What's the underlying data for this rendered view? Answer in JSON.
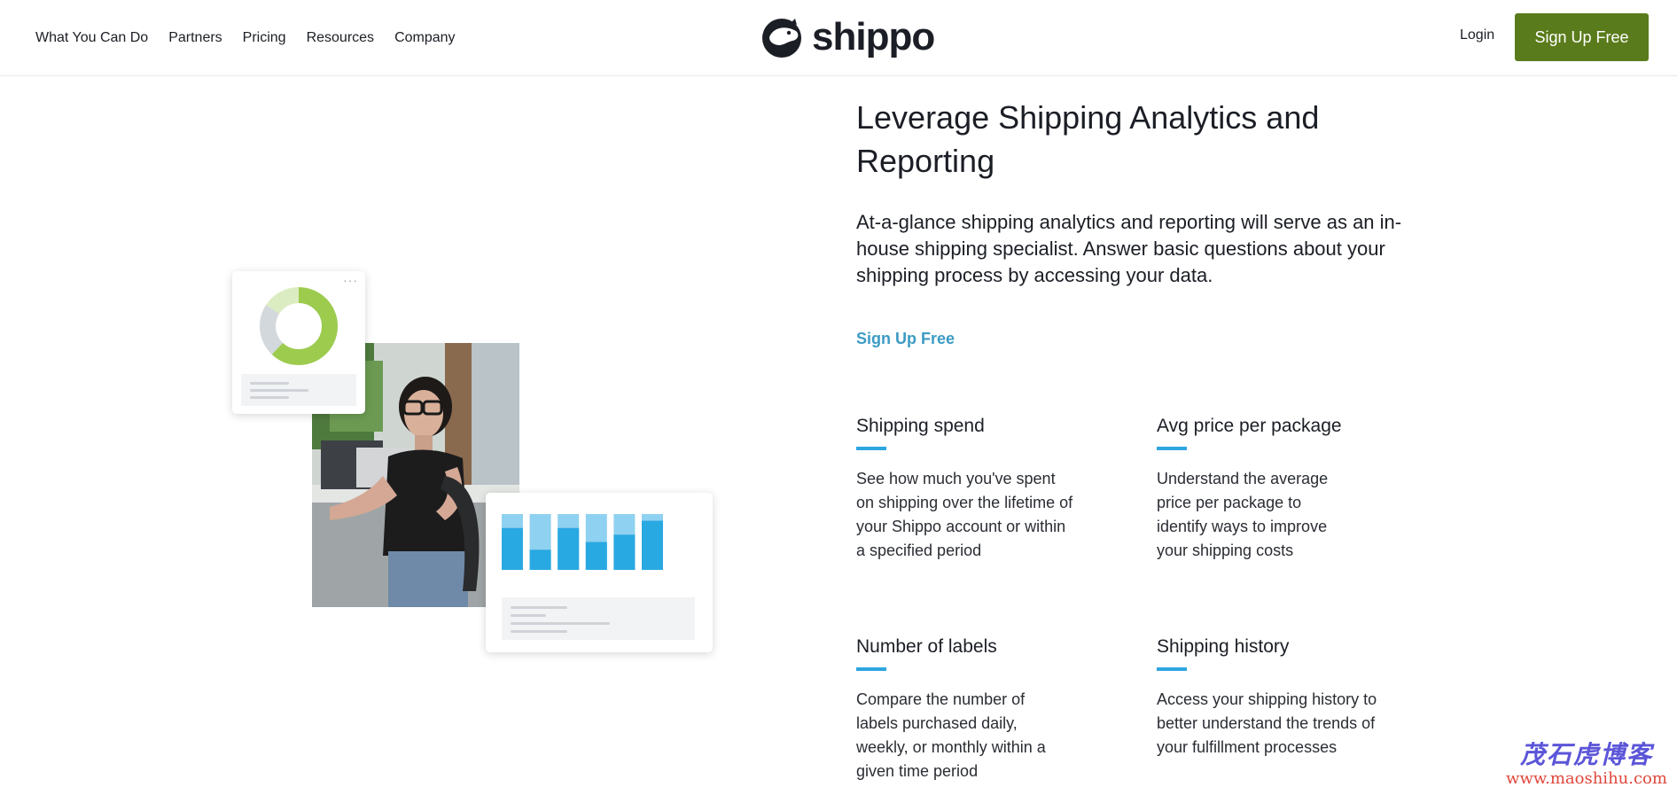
{
  "nav": {
    "items": [
      {
        "label": "What You Can Do"
      },
      {
        "label": "Partners"
      },
      {
        "label": "Pricing"
      },
      {
        "label": "Resources"
      },
      {
        "label": "Company"
      }
    ]
  },
  "brand": {
    "name": "shippo",
    "logo_icon": "shippo-hippo-icon"
  },
  "header": {
    "login_label": "Login",
    "signup_label": "Sign Up Free"
  },
  "hero": {
    "title": "Leverage Shipping Analytics and Reporting",
    "lead": "At-a-glance shipping analytics and reporting will serve as an in-house shipping specialist. Answer basic questions about your shipping process by accessing your data.",
    "cta_label": "Sign Up Free"
  },
  "illustration": {
    "donut_segments": [
      {
        "color": "#9ccb4e",
        "fraction": 0.62
      },
      {
        "color": "#d3d8dc",
        "fraction": 0.22
      },
      {
        "color": "#dcecc2",
        "fraction": 0.16
      }
    ],
    "bars": [
      {
        "total": 1.0,
        "filled": 0.75
      },
      {
        "total": 1.0,
        "filled": 0.36
      },
      {
        "total": 1.0,
        "filled": 0.75
      },
      {
        "total": 1.0,
        "filled": 0.5
      },
      {
        "total": 1.0,
        "filled": 0.63
      },
      {
        "total": 1.0,
        "filled": 0.88
      }
    ],
    "colors": {
      "bar_dark": "#29a9e1",
      "bar_light": "#8fd1f0"
    }
  },
  "features": [
    {
      "title": "Shipping spend",
      "text": "See how much you've spent on shipping over the lifetime of your Shippo account or within a specified period"
    },
    {
      "title": "Avg price per package",
      "text": "Understand the average price per package to identify ways to improve your shipping costs"
    },
    {
      "title": "Number of labels",
      "text": "Compare the number of labels purchased daily, weekly, or monthly within a given time period"
    },
    {
      "title": "Shipping history",
      "text": "Access your shipping history to better understand the trends of your fulfillment processes"
    }
  ],
  "colors": {
    "brand_green": "#5a7b1b",
    "link_blue": "#3c9bc4",
    "accent_blue": "#2ea6e0"
  },
  "watermark": {
    "cn": "茂石虎博客",
    "url": "www.maoshihu.com"
  }
}
